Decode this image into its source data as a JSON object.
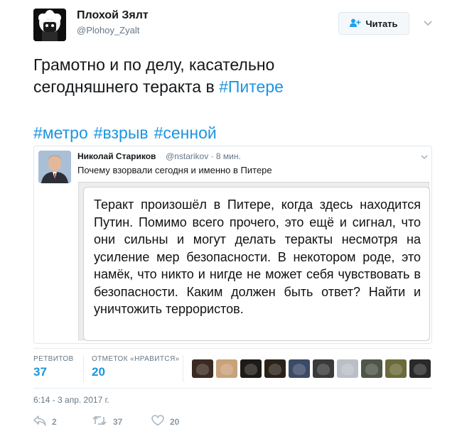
{
  "author": {
    "name": "Плохой Зялт",
    "handle": "@Plohoy_Zyalt",
    "follow_label": "Читать"
  },
  "tweet": {
    "text_line1": "Грамотно и по делу, касательно",
    "text_line2_prefix": "сегодняшнего теракта в ",
    "text_line2_hashtag": "#Питере",
    "hashtags": [
      "#метро",
      "#взрыв",
      "#сенной"
    ]
  },
  "quote": {
    "name": "Николай Стариков",
    "handle": "@nstarikov",
    "time": "8 мин.",
    "text": "Почему взорвали сегодня и именно в Питере",
    "image_text": "Теракт произошёл в Питере, когда здесь находится Путин. Помимо всего прочего, это ещё и сигнал, что они сильны и могут делать теракты несмотря на усиление мер безопасности. В некотором роде, это намёк, что никто и нигде не может себя чувствовать в безопасности. Каким должен быть ответ? Найти и уничтожить террористов."
  },
  "stats": {
    "retweets_label": "РЕТВИТОВ",
    "retweets_value": "37",
    "likes_label": "ОТМЕТОК «НРАВИТСЯ»",
    "likes_value": "20",
    "liker_avatar_colors": [
      "#3a2a22",
      "#c9a27a",
      "#1e1a16",
      "#2a2218",
      "#3b4a66",
      "#3a3a3a",
      "#b8bfc6",
      "#4f5548",
      "#6b6a3a",
      "#2a2a2a"
    ]
  },
  "timestamp": "6:14 - 3 апр. 2017 г.",
  "actions": {
    "reply_count": "2",
    "retweet_count": "37",
    "like_count": "20"
  },
  "colors": {
    "link": "#1b95e0",
    "muted": "#657786",
    "border": "#e1e8ed"
  }
}
